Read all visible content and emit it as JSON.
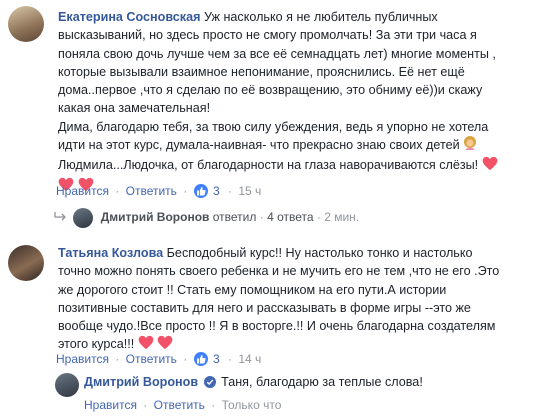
{
  "comments": [
    {
      "author": "Екатерина Сосновская",
      "lines": [
        "Уж насколько я не любитель публичных",
        "высказываний, но здесь просто не смогу промолчать! За эти три часа я",
        "поняла свою дочь лучше чем за все её семнадцать лет) многие моменты ,",
        "которые вызывали взаимное непонимание, прояснились. Её нет ещё",
        "дома..первое ,что я сделаю по её возвращению, это обниму её))и скажу",
        "какая она замечательная!",
        "Дима, благодарю тебя, за твою силу убеждения, ведь я упорно не хотела",
        "идти на этот курс, думала-наивная- что прекрасно знаю своих детей",
        "Людмила...Людочка, от благодарности на глаза наворачиваются слёзы!"
      ],
      "like_label": "Нравится",
      "reply_label": "Ответить",
      "reactions": "3",
      "time": "15 ч",
      "replies_summary": {
        "name": "Дмитрий Воронов",
        "action": "ответил",
        "count": "4 ответа",
        "time": "2 мин."
      }
    },
    {
      "author": "Татьяна Козлова",
      "lines": [
        "Бесподобный курс!! Ну настолько тонко и настолько",
        "точно можно понять своего ребенка и не мучить его не тем ,что не его .Это",
        "же дорогого стоит !! Стать ему помощником на его пути.А истории",
        "позитивные составить для него и рассказывать в форме игры --это же",
        "вообще чудо.!Все просто !! Я в восторге.!! И очень благодарна создателям",
        "этого курса!!!"
      ],
      "like_label": "Нравится",
      "reply_label": "Ответить",
      "reactions": "3",
      "time": "14 ч",
      "reply": {
        "author": "Дмитрий Воронов",
        "text": "Таня, благодарю за теплые слова!",
        "like_label": "Нравится",
        "reply_label": "Ответить",
        "time": "Только что"
      }
    }
  ],
  "colors": {
    "link": "#365899",
    "action_link": "#4267b2",
    "meta": "#90949c",
    "bubble": "#f1f2f6",
    "heart": "#f25268",
    "reaction": "#4080ff"
  },
  "icons": [
    "like-icon",
    "heart-icon",
    "woman-emoji-icon",
    "reply-arrow-icon",
    "verified-icon"
  ]
}
